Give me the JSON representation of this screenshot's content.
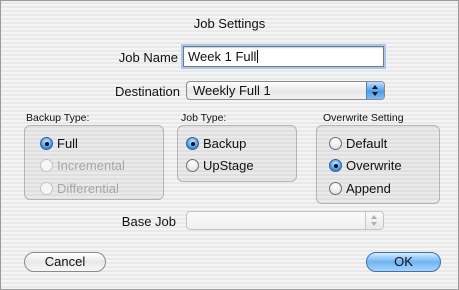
{
  "dialog": {
    "title": "Job Settings"
  },
  "job_name": {
    "label": "Job Name",
    "value": "Week 1 Full"
  },
  "destination": {
    "label": "Destination",
    "value": "Weekly Full 1"
  },
  "backup_type": {
    "label": "Backup Type:",
    "options": [
      {
        "label": "Full",
        "selected": true,
        "enabled": true
      },
      {
        "label": "Incremental",
        "selected": false,
        "enabled": false
      },
      {
        "label": "Differential",
        "selected": false,
        "enabled": false
      }
    ]
  },
  "job_type": {
    "label": "Job Type:",
    "options": [
      {
        "label": "Backup",
        "selected": true
      },
      {
        "label": "UpStage",
        "selected": false
      }
    ]
  },
  "overwrite": {
    "label": "Overwrite Setting",
    "options": [
      {
        "label": "Default",
        "selected": false
      },
      {
        "label": "Overwrite",
        "selected": true
      },
      {
        "label": "Append",
        "selected": false
      }
    ]
  },
  "base_job": {
    "label": "Base Job",
    "value": ""
  },
  "buttons": {
    "cancel": "Cancel",
    "ok": "OK"
  },
  "colors": {
    "accent": "#4d9de8",
    "focus_ring": "#a6c7ef"
  }
}
